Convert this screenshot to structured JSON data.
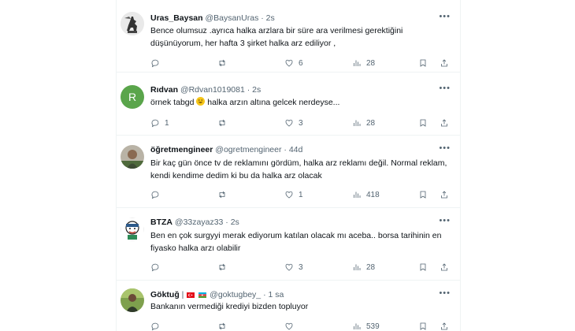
{
  "tweets": [
    {
      "name": "Uras_Baysan",
      "handle": "@BaysanUras",
      "time": "2s",
      "avatar": "knight-statue-avatar",
      "text": "Bence olumsuz .ayrıca halka arzlara bir süre ara verilmesi gerektiğini düşünüyorum, her hafta 3 şirket halka arz ediliyor ,",
      "replies": "",
      "retweets": "",
      "likes": "6",
      "views": "28"
    },
    {
      "name": "Rıdvan",
      "handle": "@Rdvan1019081",
      "time": "2s",
      "avatar": "R",
      "avatar_color": "#5aa54b",
      "text_before": "örnek tabgd ",
      "text_after": " halka arzın altına gelcek nerdeyse...",
      "replies": "1",
      "retweets": "",
      "likes": "3",
      "views": "28"
    },
    {
      "name": "öğretmengineer",
      "handle": "@ogretmengineer",
      "time": "44d",
      "avatar": "person-photo-avatar",
      "text": "Bir kaç gün önce tv de reklamını gördüm, halka arz reklamı değil. Normal reklam, kendi kendime dedim ki bu da halka arz olacak",
      "replies": "",
      "retweets": "",
      "likes": "1",
      "views": "418"
    },
    {
      "name": "BTZA",
      "handle": "@33zayaz33",
      "time": "2s",
      "avatar": "cartoon-avatar",
      "text": "Ben en çok surgyyi merak ediyorum katılan olacak mı aceba.. borsa tarihinin en fiyasko halka arzı olabilir",
      "replies": "",
      "retweets": "",
      "likes": "3",
      "views": "28"
    },
    {
      "name": "Göktuğ",
      "separator": "|",
      "handle": "@goktugbey_",
      "time": "1 sa",
      "avatar": "outdoor-photo-avatar",
      "text": "Bankanın vermediği krediyi bizden topluyor",
      "replies": "",
      "retweets": "",
      "likes": "",
      "views": "539"
    }
  ],
  "dot": "·",
  "colors": {
    "secondary_text": "#536471",
    "divider": "#eff3f4",
    "primary_text": "#0f1419"
  }
}
